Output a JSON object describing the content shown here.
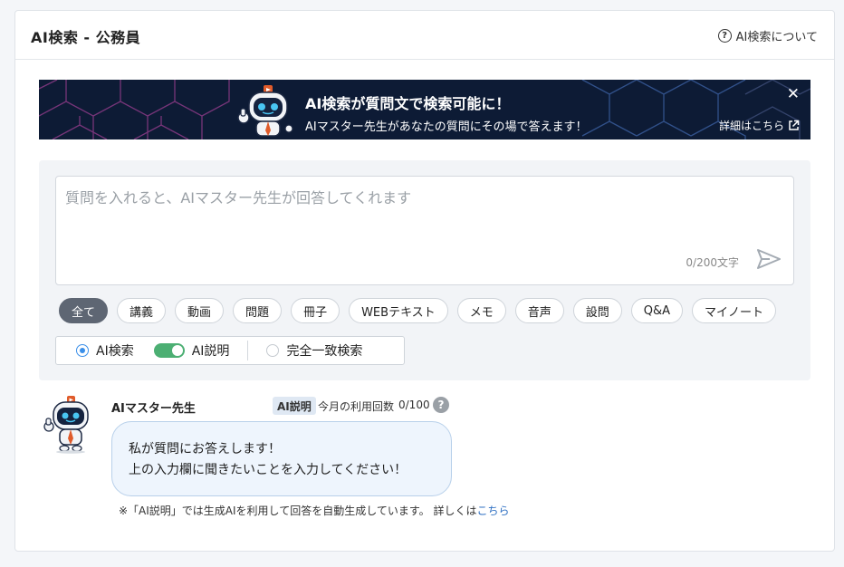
{
  "header": {
    "title": "AI検索 - 公務員",
    "about_link": "AI検索について",
    "help_icon": "question-circle-icon"
  },
  "banner": {
    "title": "AI検索が質問文で検索可能に！",
    "subtitle": "AIマスター先生があなたの質問にその場で答えます！",
    "detail_link": "詳細はこちら",
    "close_icon": "close-icon",
    "external_icon": "external-link-icon",
    "background_color": "#0d1b35"
  },
  "search": {
    "placeholder": "質問を入れると、AIマスター先生が回答してくれます",
    "value": "",
    "char_count": "0/200文字",
    "send_icon": "send-icon"
  },
  "filters": [
    {
      "label": "全て",
      "active": true
    },
    {
      "label": "講義",
      "active": false
    },
    {
      "label": "動画",
      "active": false
    },
    {
      "label": "問題",
      "active": false
    },
    {
      "label": "冊子",
      "active": false
    },
    {
      "label": "WEBテキスト",
      "active": false
    },
    {
      "label": "メモ",
      "active": false
    },
    {
      "label": "音声",
      "active": false
    },
    {
      "label": "設問",
      "active": false
    },
    {
      "label": "Q&A",
      "active": false
    },
    {
      "label": "マイノート",
      "active": false
    }
  ],
  "modes": {
    "ai_search": {
      "label": "AI検索",
      "selected": true
    },
    "ai_explain": {
      "label": "AI説明",
      "enabled": true
    },
    "exact_match": {
      "label": "完全一致検索",
      "selected": false
    }
  },
  "assistant": {
    "name": "AIマスター先生",
    "badge": "AI説明",
    "usage_label": "今月の利用回数",
    "usage_count": "0/100",
    "help_glyph": "?",
    "message_line1": "私が質問にお答えします！",
    "message_line2": "上の入力欄に聞きたいことを入力してください！"
  },
  "footnote": {
    "text": "※「AI説明」では生成AIを利用して回答を自動生成しています。 詳しくは",
    "link": "こちら"
  },
  "colors": {
    "accent_blue": "#3b8fe9",
    "toggle_green": "#4caf73",
    "chip_active": "#5e6673",
    "link": "#2d6fc2"
  }
}
